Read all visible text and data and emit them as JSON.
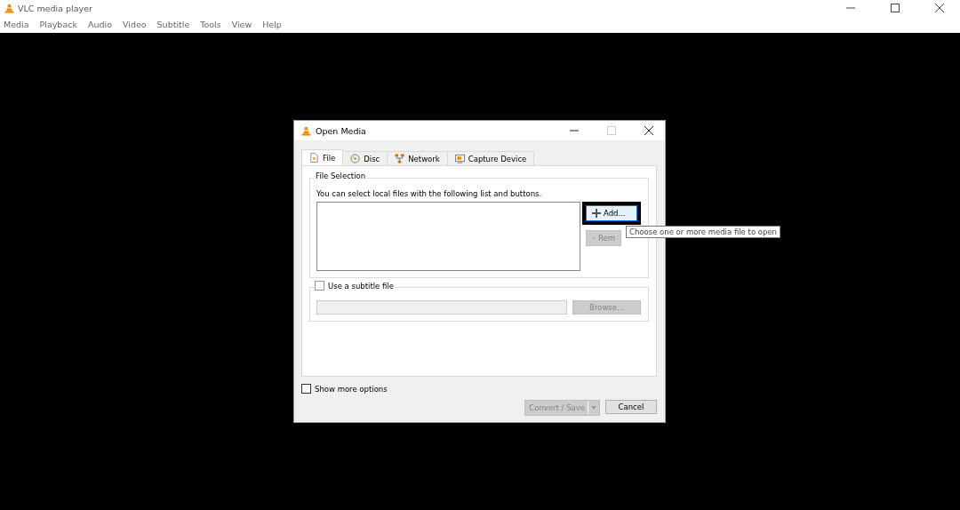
{
  "window": {
    "title": "VLC media player"
  },
  "menu": [
    "Media",
    "Playback",
    "Audio",
    "Video",
    "Subtitle",
    "Tools",
    "View",
    "Help"
  ],
  "dialog": {
    "title": "Open Media",
    "tabs": [
      {
        "label": "File",
        "selected": true
      },
      {
        "label": "Disc",
        "selected": false
      },
      {
        "label": "Network",
        "selected": false
      },
      {
        "label": "Capture Device",
        "selected": false
      }
    ],
    "file_selection": {
      "title": "File Selection",
      "description": "You can select local files with the following list and buttons.",
      "buttons": [
        {
          "label": "Add...",
          "disabled": false,
          "focused": true
        },
        {
          "label": "Rem",
          "disabled": true,
          "focused": false
        }
      ]
    },
    "subtitle": {
      "label": "Use a subtitle file",
      "checked": false,
      "browse": {
        "label": "Browse...",
        "disabled": true
      }
    },
    "show_more": {
      "label": "Show more options",
      "checked": false
    },
    "convert": {
      "label": "Convert / Save",
      "disabled": true
    },
    "cancel": {
      "label": "Cancel",
      "disabled": false
    },
    "tooltip": "Choose one or more media file to open"
  }
}
